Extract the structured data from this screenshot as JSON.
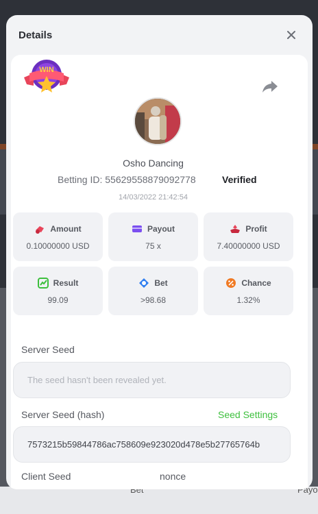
{
  "background": {
    "left_text": "Bet",
    "right_text": "Payo"
  },
  "modal": {
    "title": "Details"
  },
  "player": {
    "name": "Osho Dancing",
    "avatar_icon": "player-avatar"
  },
  "bet": {
    "id_label": "Betting ID:",
    "id_value": "55629558879092778",
    "verified": "Verified",
    "timestamp": "14/03/2022 21:42:54"
  },
  "stats": [
    {
      "key": "amount",
      "label": "Amount",
      "value": "0.10000000 USD",
      "icon": "amount-icon",
      "color": "#e8455a"
    },
    {
      "key": "payout",
      "label": "Payout",
      "value": "75 x",
      "icon": "card-icon",
      "color": "#7b4ff0"
    },
    {
      "key": "profit",
      "label": "Profit",
      "value": "7.40000000 USD",
      "icon": "profit-icon",
      "color": "#e8455a"
    },
    {
      "key": "result",
      "label": "Result",
      "value": "99.09",
      "icon": "chart-icon",
      "color": "#3cbf3c"
    },
    {
      "key": "bet",
      "label": "Bet",
      "value": ">98.68",
      "icon": "target-icon",
      "color": "#2f7ef0"
    },
    {
      "key": "chance",
      "label": "Chance",
      "value": "1.32%",
      "icon": "percent-icon",
      "color": "#f07a24"
    }
  ],
  "server_seed": {
    "label": "Server Seed",
    "placeholder": "The seed hasn't been revealed yet."
  },
  "server_seed_hash": {
    "label": "Server Seed (hash)",
    "settings_link": "Seed Settings",
    "value": "7573215b59844786ac758609e923020d478e5b27765764b"
  },
  "client_seed": {
    "label": "Client Seed"
  },
  "nonce": {
    "label": "nonce"
  },
  "colors": {
    "accent_green": "#3cbf3c"
  }
}
